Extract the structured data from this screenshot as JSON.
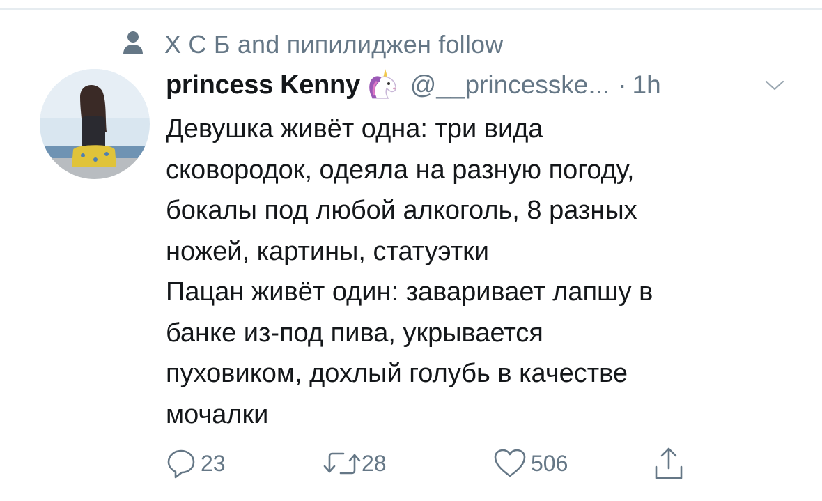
{
  "social_context": {
    "icon": "person-icon",
    "text": "Х С Б and пипилиджен follow"
  },
  "tweet": {
    "display_name": "princess Kenny",
    "name_emoji": "unicorn-icon",
    "handle": "@__princesske...",
    "separator": "·",
    "time": "1h",
    "avatar": "avatar",
    "text_lines": [
      "Девушка живёт одна: три вида",
      "сковородок, одеяла на разную погоду,",
      "бокалы под любой алкоголь, 8 разных",
      "ножей, картины, статуэтки",
      "Пацан живёт один: заваривает лапшу в",
      "банке из-под пива, укрывается",
      "пуховиком, дохлый голубь в качестве",
      "мочалки"
    ]
  },
  "actions": {
    "reply": {
      "icon": "reply-icon",
      "count": "23"
    },
    "retweet": {
      "icon": "retweet-icon",
      "count": "28"
    },
    "like": {
      "icon": "heart-icon",
      "count": "506"
    },
    "share": {
      "icon": "share-icon"
    }
  },
  "colors": {
    "text_primary": "#14171a",
    "text_secondary": "#657786",
    "divider": "#e6ecf0"
  }
}
